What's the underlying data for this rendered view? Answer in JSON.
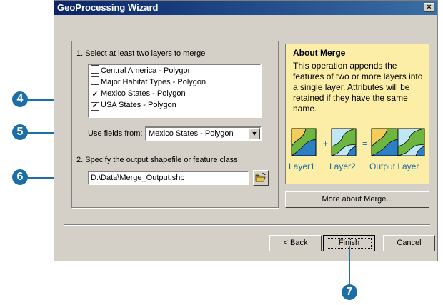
{
  "window": {
    "title": "GeoProcessing Wizard",
    "close_label": "×"
  },
  "step1": {
    "label": "1. Select at least two layers to merge"
  },
  "layers": [
    {
      "label": "Central America - Polygon",
      "checked": false
    },
    {
      "label": "Major Habitat Types - Polygon",
      "checked": false
    },
    {
      "label": "Mexico States - Polygon",
      "checked": true
    },
    {
      "label": "USA States - Polygon",
      "checked": true
    }
  ],
  "use_fields": {
    "label": "Use fields from:",
    "value": "Mexico States - Polygon"
  },
  "step2": {
    "label": "2. Specify the output shapefile or feature class"
  },
  "output_path": {
    "value": "D:\\Data\\Merge_Output.shp"
  },
  "about": {
    "title": "About Merge",
    "text": "This operation appends the features of two or more layers into a single layer.  Attributes will be retained if they have the same name.",
    "layer1": "Layer1",
    "plus": "+",
    "layer2": "Layer2",
    "equals": "=",
    "output": "Output Layer"
  },
  "more_button": {
    "label": "More about Merge..."
  },
  "buttons": {
    "back_prefix": "< ",
    "back_key": "B",
    "back_rest": "ack",
    "finish": "Finish",
    "cancel": "Cancel"
  },
  "callouts": [
    "4",
    "5",
    "6",
    "7"
  ]
}
